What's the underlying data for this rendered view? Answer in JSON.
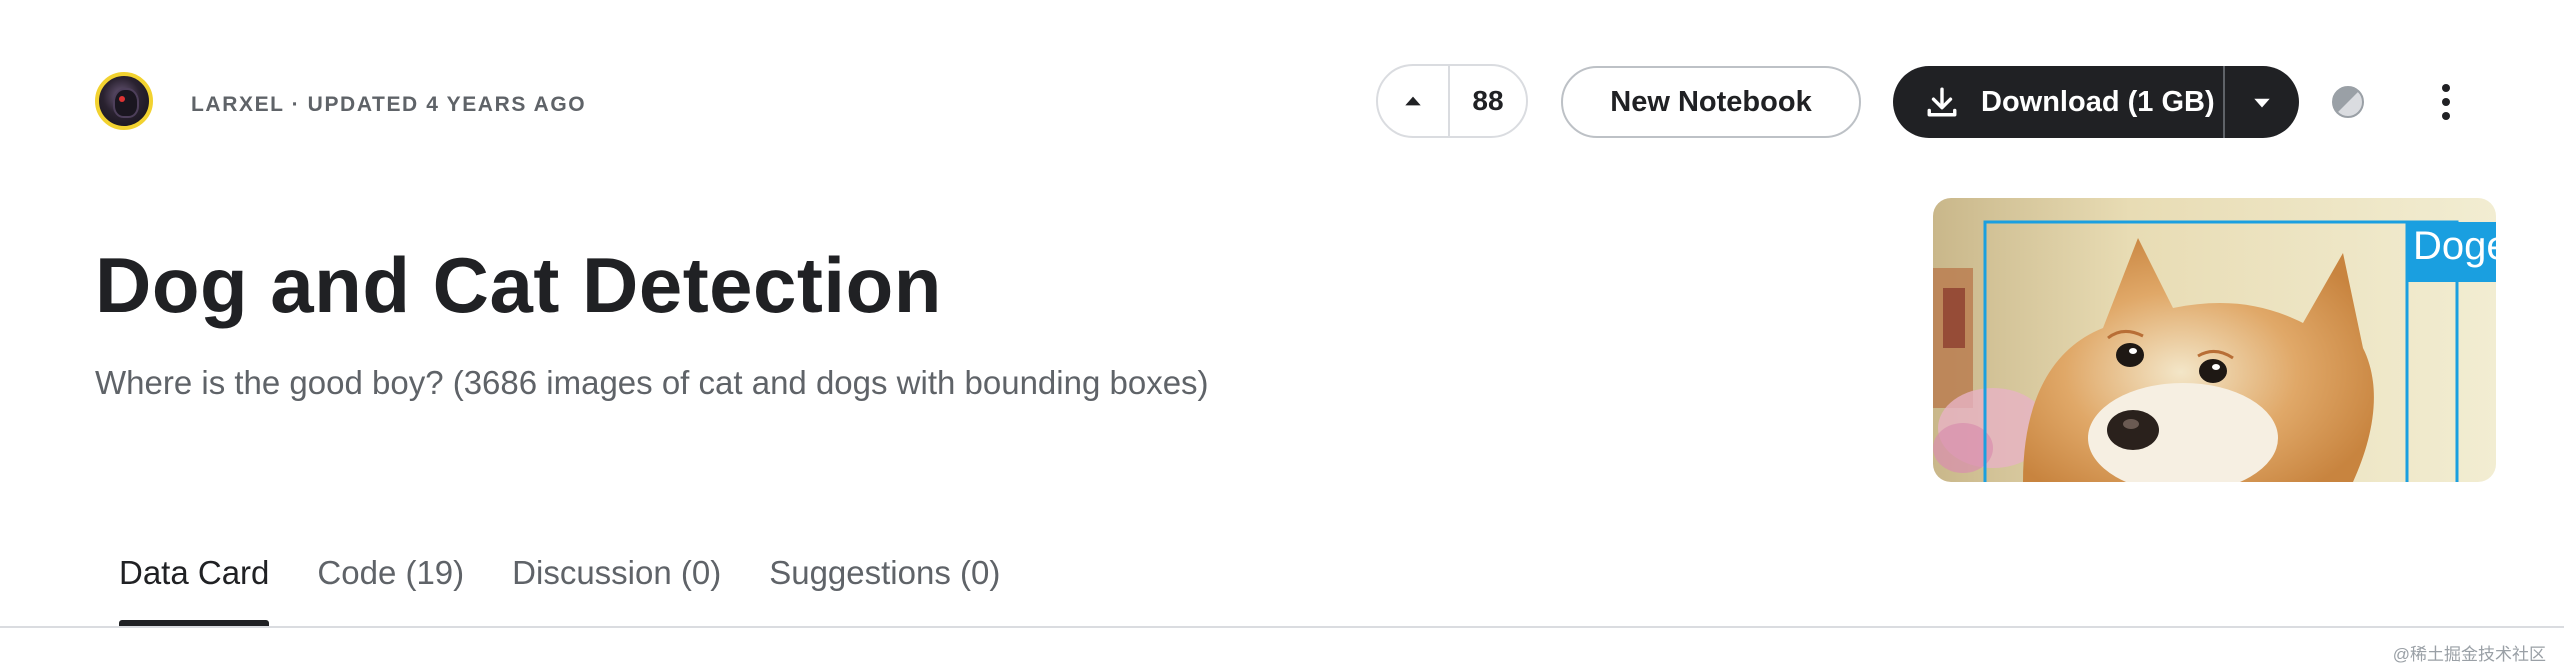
{
  "author": {
    "meta_text": "LARXEL · UPDATED 4 YEARS AGO"
  },
  "actions": {
    "vote_count": "88",
    "new_notebook_label": "New Notebook",
    "download_label": "Download (1 GB)"
  },
  "dataset": {
    "title": "Dog and Cat Detection",
    "subtitle": "Where is the good boy? (3686 images of cat and dogs with bounding boxes)",
    "cover_box_label": "Doge"
  },
  "tabs": [
    {
      "label": "Data Card",
      "active": true
    },
    {
      "label": "Code (19)",
      "active": false
    },
    {
      "label": "Discussion (0)",
      "active": false
    },
    {
      "label": "Suggestions (0)",
      "active": false
    }
  ],
  "watermark": "@稀土掘金技术社区",
  "icons": {
    "avatar": "avatar",
    "upvote": "triangle-up-icon",
    "download": "download-icon",
    "dropdown": "caret-down-icon",
    "theme": "theme-toggle-icon",
    "more": "kebab-menu-icon"
  },
  "colors": {
    "primary_dark": "#202124",
    "avatar_ring": "#f2d230",
    "bbox_blue": "#1a9fe0"
  }
}
